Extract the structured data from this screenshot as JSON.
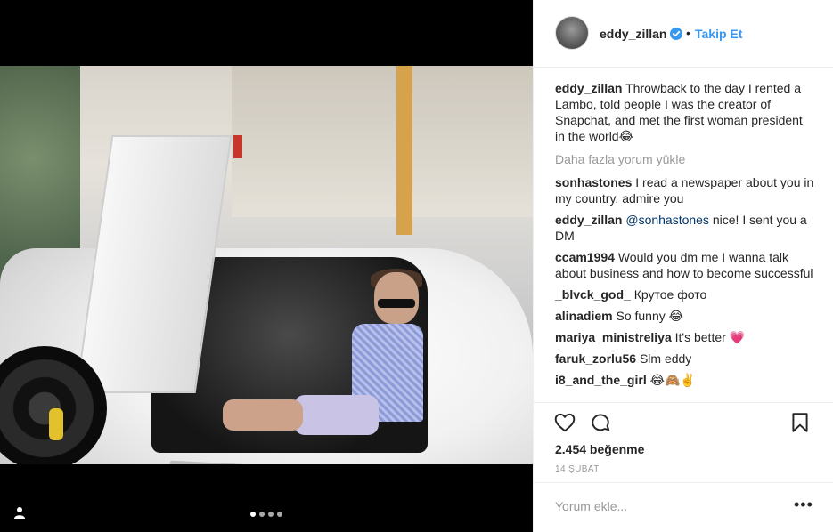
{
  "post": {
    "username": "eddy_zillan",
    "verified": true,
    "follow_label": "Takip Et",
    "bullet": "•"
  },
  "caption": {
    "user": "eddy_zillan",
    "text": "Throwback to the day I rented a Lambo, told people I was the creator of Snapchat, and met the first woman president in the world😂"
  },
  "load_more": "Daha fazla yorum yükle",
  "comments": [
    {
      "user": "sonhastones",
      "mention": "",
      "text": "I read a newspaper about you in my country. admire you"
    },
    {
      "user": "eddy_zillan",
      "mention": "@sonhastones",
      "text": "nice! I sent you a DM"
    },
    {
      "user": "ccam1994",
      "mention": "",
      "text": "Would you dm me I wanna talk about business and how to become successful"
    },
    {
      "user": "_blvck_god_",
      "mention": "",
      "text": "Крутое фото"
    },
    {
      "user": "alinadiem",
      "mention": "",
      "text": "So funny 😂"
    },
    {
      "user": "mariya_ministreliya",
      "mention": "",
      "text": "It's better 💗"
    },
    {
      "user": "faruk_zorlu56",
      "mention": "",
      "text": "Slm eddy"
    },
    {
      "user": "i8_and_the_girl",
      "mention": "",
      "text": "😂🙈✌️"
    }
  ],
  "likes": "2.454 beğenme",
  "date": "14 ŞUBAT",
  "comment_input": {
    "placeholder": "Yorum ekle..."
  },
  "more_label": "•••",
  "carousel": {
    "count": 4,
    "active": 0
  },
  "colors": {
    "accent": "#3897f0",
    "text": "#262626",
    "muted": "#999999",
    "border": "#efefef"
  },
  "icons": [
    "user-tag-icon",
    "heart-icon",
    "comment-icon",
    "bookmark-icon",
    "verified-badge-icon"
  ]
}
